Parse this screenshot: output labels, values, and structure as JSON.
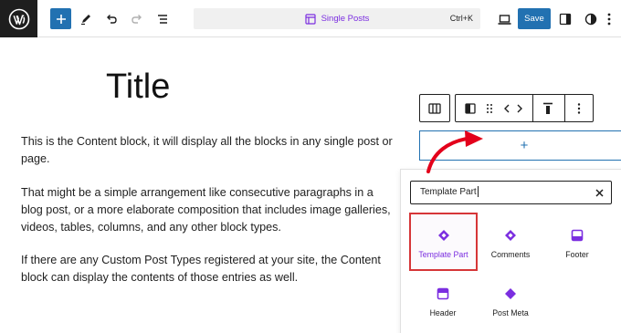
{
  "topbar": {
    "document_title": "Single Posts",
    "shortcut": "Ctrl+K",
    "save_label": "Save"
  },
  "icons": {
    "logo": "wordpress-logo",
    "add": "plus-icon",
    "tools": "pencil-icon",
    "undo": "undo-icon",
    "redo": "redo-icon",
    "outline": "list-view-icon",
    "preview": "laptop-icon",
    "settings": "sidebar-toggle-icon",
    "styles": "half-circle-icon",
    "options": "more-vertical-icon"
  },
  "canvas": {
    "title": "Title",
    "paragraphs": [
      "This is the Content block, it will display all the blocks in any single post or page.",
      "That might be a simple arrangement like consecutive paragraphs in a blog post, or a more elaborate composition that includes image galleries, videos, tables, columns, and any other block types.",
      "If there are any Custom Post Types registered at your site, the Content block can display the contents of those entries as well."
    ]
  },
  "appender": {
    "symbol": "+"
  },
  "inserter": {
    "search_value": "Template Part",
    "blocks": [
      {
        "label": "Template Part",
        "icon": "template-part-diamond-icon",
        "selected": true
      },
      {
        "label": "Comments",
        "icon": "comments-diamond-icon",
        "selected": false
      },
      {
        "label": "Footer",
        "icon": "footer-icon",
        "selected": false
      },
      {
        "label": "Header",
        "icon": "header-icon",
        "selected": false
      },
      {
        "label": "Post Meta",
        "icon": "post-meta-diamond-icon",
        "selected": false
      }
    ]
  },
  "colors": {
    "accent_blue": "#2271b1",
    "block_purple": "#7b2ee0",
    "highlight_red": "#d63638",
    "dark": "#1e1e1e"
  }
}
